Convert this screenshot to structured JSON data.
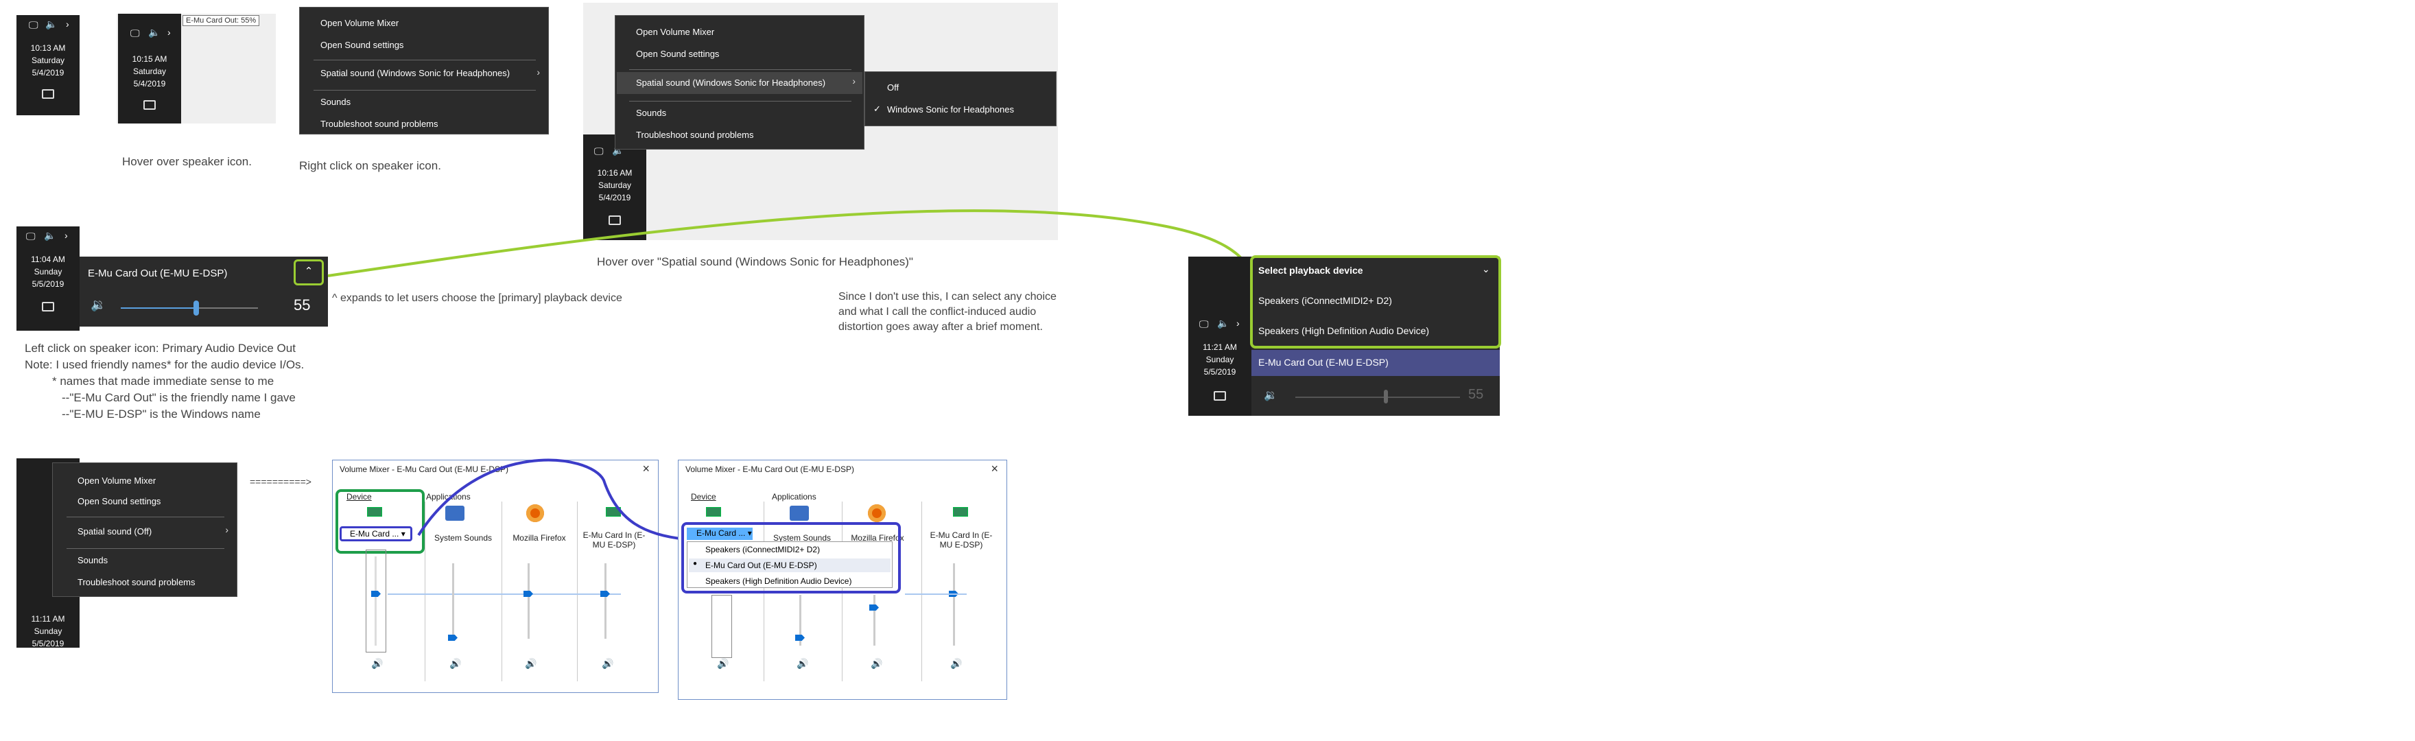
{
  "clock1": {
    "time": "10:13 AM",
    "day": "Saturday",
    "date": "5/4/2019"
  },
  "clock2": {
    "time": "10:15 AM",
    "day": "Saturday",
    "date": "5/4/2019",
    "tooltip": "E-Mu Card Out: 55%"
  },
  "clock3": {
    "time": "10:16 AM",
    "day": "Saturday",
    "date": "5/4/2019"
  },
  "clock4": {
    "time": "11:04 AM",
    "day": "Sunday",
    "date": "5/5/2019"
  },
  "clock5": {
    "time": "11:21 AM",
    "day": "Sunday",
    "date": "5/5/2019"
  },
  "clock6": {
    "time": "11:11 AM",
    "day": "Sunday",
    "date": "5/5/2019"
  },
  "context_menu": {
    "open_mixer": "Open Volume Mixer",
    "open_settings": "Open Sound settings",
    "spatial": "Spatial sound (Windows Sonic for Headphones)",
    "sounds": "Sounds",
    "troubleshoot": "Troubleshoot sound problems"
  },
  "context_menu_off": {
    "open_mixer": "Open Volume Mixer",
    "open_settings": "Open Sound settings",
    "spatial": "Spatial sound (Off)",
    "sounds": "Sounds",
    "troubleshoot": "Troubleshoot sound problems"
  },
  "spatial_submenu": {
    "off": "Off",
    "sonic": "Windows Sonic for Headphones"
  },
  "captions": {
    "hover_icon": "Hover over speaker icon.",
    "right_click": "Right click on speaker icon.",
    "hover_spatial": "Hover over \"Spatial sound (Windows Sonic for Headphones)\"",
    "expands": "^ expands to let users choose the [primary] playback device",
    "since1": "Since I don't use this, I can select any choice",
    "since2": "and what I call the conflict-induced audio",
    "since3": "distortion goes away after a brief moment.",
    "left1": "Left click on speaker icon: Primary Audio Device Out",
    "left2": "Note: I used friendly names* for the audio device I/Os.",
    "left3": "* names that made immediate sense to me",
    "left4": "--\"E-Mu Card Out\" is the friendly name I gave",
    "left5": "--\"E-MU E-DSP\" is the Windows name",
    "arrow": "==========>"
  },
  "volume_flyout": {
    "device": "E-Mu Card Out (E-MU E-DSP)",
    "level": "55",
    "level_fraction": 0.55
  },
  "playback": {
    "header": "Select playback device",
    "items": [
      "Speakers (iConnectMIDI2+ D2)",
      "Speakers (High Definition Audio Device)",
      "E-Mu Card Out (E-MU E-DSP)"
    ],
    "level": "55"
  },
  "mixer": {
    "title": "Volume Mixer - E-Mu Card Out (E-MU E-DSP)",
    "device_label": "Device",
    "apps_label": "Applications",
    "device_select": "E-Mu Card ...",
    "channels": [
      "System Sounds",
      "Mozilla Firefox",
      "E-Mu Card In (E-MU E-DSP)"
    ],
    "dropdown": [
      "Speakers (iConnectMIDI2+ D2)",
      "E-Mu Card Out (E-MU E-DSP)",
      "Speakers (High Definition Audio Device)"
    ]
  },
  "colors": {
    "accent_green": "#9acd32",
    "accent_blue": "#3c3cc8",
    "dark_green": "#1e9e4a",
    "selected": "#4a4f8a"
  }
}
